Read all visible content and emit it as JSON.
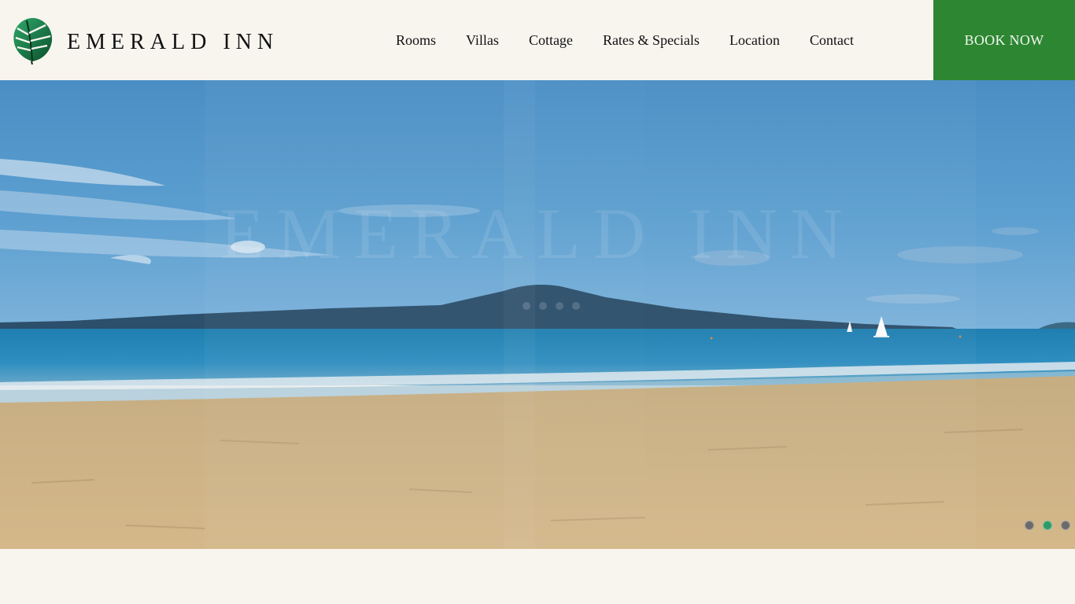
{
  "site": {
    "logo_text": "EMERALD INN",
    "logo_icon": "monstera-leaf-icon"
  },
  "nav": {
    "items": [
      {
        "label": "Rooms"
      },
      {
        "label": "Villas"
      },
      {
        "label": "Cottage"
      },
      {
        "label": "Rates & Specials"
      },
      {
        "label": "Location"
      },
      {
        "label": "Contact"
      }
    ]
  },
  "book_button": {
    "label": "BOOK NOW"
  },
  "hero": {
    "watermark_text": "EMERALD INN",
    "slider": {
      "slide_count": 3,
      "active_index": 1
    }
  },
  "colors": {
    "page_background": "#f8f5ef",
    "book_button": "#2d8632",
    "active_dot": "#2e9a6a",
    "inactive_dot": "#6b6b6b"
  }
}
